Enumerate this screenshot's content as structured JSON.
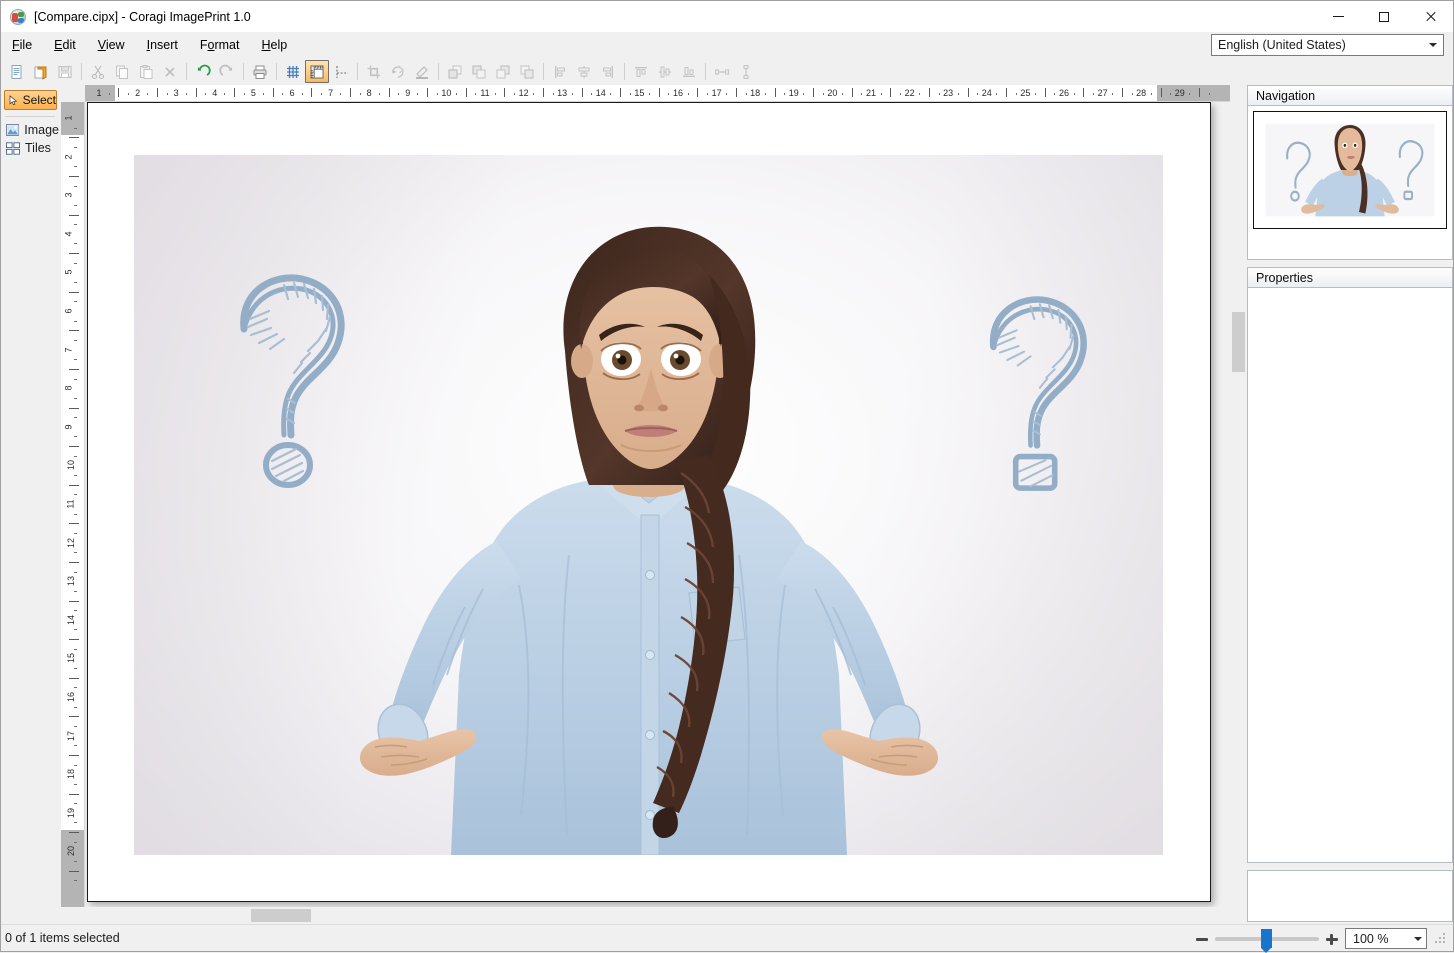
{
  "window": {
    "title": "[Compare.cipx] - Coragi ImagePrint 1.0",
    "icon": "app-logo-icon",
    "minimize": "minimize-icon",
    "maximize": "maximize-icon",
    "close": "close-icon"
  },
  "menu": {
    "items": [
      {
        "label": "File",
        "accel": "F"
      },
      {
        "label": "Edit",
        "accel": "E"
      },
      {
        "label": "View",
        "accel": "V"
      },
      {
        "label": "Insert",
        "accel": "I"
      },
      {
        "label": "Format",
        "accel": "o"
      },
      {
        "label": "Help",
        "accel": "H"
      }
    ],
    "language": {
      "value": "English (United States)",
      "options": [
        "English (United States)"
      ]
    }
  },
  "toolbar": {
    "buttons": [
      {
        "name": "new-document-button",
        "icon": "new-document-icon",
        "enabled": true
      },
      {
        "name": "open-document-button",
        "icon": "open-folder-icon",
        "enabled": true
      },
      {
        "name": "save-button",
        "icon": "floppy-disk-icon",
        "enabled": false
      },
      {
        "name": "cut-button",
        "icon": "scissors-icon",
        "enabled": false
      },
      {
        "name": "copy-button",
        "icon": "copy-icon",
        "enabled": false
      },
      {
        "name": "paste-button",
        "icon": "paste-icon",
        "enabled": false
      },
      {
        "name": "delete-button",
        "icon": "x-cross-icon",
        "enabled": false
      },
      {
        "name": "undo-button",
        "icon": "undo-arrow-icon",
        "enabled": true
      },
      {
        "name": "redo-button",
        "icon": "redo-arrow-icon",
        "enabled": false
      },
      {
        "name": "print-button",
        "icon": "printer-icon",
        "enabled": true
      },
      {
        "name": "show-grid-button",
        "icon": "grid-icon",
        "enabled": true
      },
      {
        "name": "show-rulers-button",
        "icon": "ruler-icon",
        "enabled": true,
        "active": true
      },
      {
        "name": "show-guides-button",
        "icon": "guides-icon",
        "enabled": true
      },
      {
        "name": "crop-button",
        "icon": "crop-icon",
        "enabled": false
      },
      {
        "name": "rotate-button",
        "icon": "rotate-icon",
        "enabled": false
      },
      {
        "name": "effects-button",
        "icon": "brush-icon",
        "enabled": false
      },
      {
        "name": "bring-to-front-button",
        "icon": "bring-to-front-icon",
        "enabled": false
      },
      {
        "name": "bring-forward-button",
        "icon": "bring-forward-icon",
        "enabled": false
      },
      {
        "name": "send-backward-button",
        "icon": "send-backward-icon",
        "enabled": false
      },
      {
        "name": "send-to-back-button",
        "icon": "send-to-back-icon",
        "enabled": false
      },
      {
        "name": "align-left-button",
        "icon": "align-left-icon",
        "enabled": false
      },
      {
        "name": "align-center-button",
        "icon": "align-center-icon",
        "enabled": false
      },
      {
        "name": "align-right-button",
        "icon": "align-right-icon",
        "enabled": false
      },
      {
        "name": "align-top-button",
        "icon": "align-top-icon",
        "enabled": false
      },
      {
        "name": "align-middle-button",
        "icon": "align-middle-icon",
        "enabled": false
      },
      {
        "name": "align-bottom-button",
        "icon": "align-bottom-icon",
        "enabled": false
      },
      {
        "name": "distribute-horizontal-button",
        "icon": "distribute-horizontal-icon",
        "enabled": false
      },
      {
        "name": "distribute-vertical-button",
        "icon": "distribute-vertical-icon",
        "enabled": false
      }
    ]
  },
  "tools": {
    "select": {
      "label": "Select",
      "icon": "cursor-arrow-icon",
      "active": true
    },
    "items": [
      {
        "label": "Image",
        "icon": "picture-icon"
      },
      {
        "label": "Tiles",
        "icon": "tiles-grid-icon"
      }
    ]
  },
  "rulers": {
    "unit": "cm",
    "horizontal_labels": [
      "1",
      "2",
      "3",
      "4",
      "5",
      "6",
      "7",
      "8",
      "9",
      "10",
      "11",
      "12",
      "13",
      "14",
      "15",
      "16",
      "17",
      "18",
      "19",
      "20",
      "21",
      "22",
      "23",
      "24",
      "25",
      "26",
      "27",
      "28",
      "29"
    ],
    "vertical_labels": [
      "1",
      "2",
      "3",
      "4",
      "5",
      "6",
      "7",
      "8",
      "9",
      "10",
      "11",
      "12",
      "13",
      "14",
      "15",
      "16",
      "17",
      "18",
      "19",
      "20"
    ]
  },
  "canvas": {
    "page_label": "document-page",
    "image_alt": "woman-shrugging-with-question-marks"
  },
  "dock": {
    "navigation": {
      "title": "Navigation"
    },
    "properties": {
      "title": "Properties"
    }
  },
  "status": {
    "selection_text": "0 of 1 items selected",
    "zoom": {
      "value": "100 %",
      "minus": "zoom-out-icon",
      "plus": "zoom-in-icon",
      "slider_percent": 45
    }
  },
  "colors": {
    "accent_orange": "#fcb24f",
    "accent_blue": "#1874cd",
    "window_bg": "#f0f0f0",
    "grid_blue": "#4a7ebb",
    "shirt_blue": "#b8cfe4",
    "qmark_blue": "#8fa9c4"
  }
}
